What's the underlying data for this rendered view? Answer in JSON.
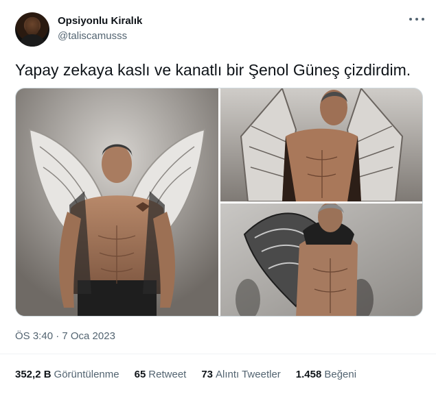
{
  "author": {
    "name": "Opsiyonlu Kiralık",
    "handle": "@taliscamusss"
  },
  "more_icon": "more-dots-icon",
  "tweet": {
    "text": "Yapay zekaya kaslı ve kanatlı bir Şenol Güneş çizdirdim."
  },
  "timestamp": "ÖS 3:40 · 7 Oca 2023",
  "stats": [
    {
      "value": "352,2 B",
      "label": "Görüntülenme"
    },
    {
      "value": "65",
      "label": "Retweet"
    },
    {
      "value": "73",
      "label": "Alıntı Tweetler"
    },
    {
      "value": "1.458",
      "label": "Beğeni"
    }
  ],
  "colors": {
    "text_primary": "#0f1419",
    "text_secondary": "#536471",
    "border": "#cfd9de",
    "divider": "#eff3f4"
  }
}
